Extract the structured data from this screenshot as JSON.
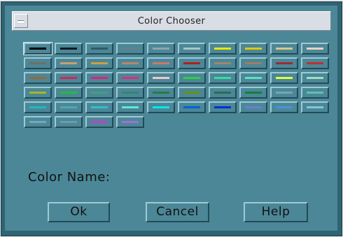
{
  "window": {
    "title": "Color Chooser"
  },
  "swatches": [
    "#000000",
    "#0a1a1f",
    "#2c5c6a",
    "#62818a",
    "#8da6ad",
    "#aac4ca",
    "#e8e800",
    "#e0c800",
    "#d8c880",
    "#e6d5c0",
    "#6f6f66",
    "#cc9e6e",
    "#caa040",
    "#b28a6a",
    "#c87a6a",
    "#b02020",
    "#a0866a",
    "#9a7f62",
    "#a02838",
    "#c03030",
    "#9a6836",
    "#d02858",
    "#e02080",
    "#e02c7a",
    "#f0c8c8",
    "#30d040",
    "#30e0a0",
    "#60e0c0",
    "#e0ff40",
    "#a0e0c0",
    "#a8b820",
    "#20c030",
    "#40a080",
    "#308870",
    "#208040",
    "#6c9010",
    "#2c6c50",
    "#108040",
    "#76a6b2",
    "#60c0b0",
    "#20b8c0",
    "#50a8b0",
    "#30c0c8",
    "#60e8d8",
    "#00e8e8",
    "#0060e0",
    "#0030d0",
    "#6c7ed0",
    "#4c90d8",
    "#80c8d8",
    "#70a8c0",
    "#6a9cb0",
    "#c040c8",
    "#a070d8"
  ],
  "labels": {
    "color_name": "Color Name:"
  },
  "buttons": {
    "ok": "Ok",
    "cancel": "Cancel",
    "help": "Help"
  }
}
